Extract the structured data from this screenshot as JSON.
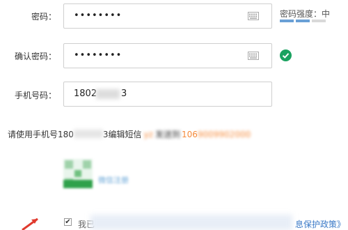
{
  "password": {
    "label": "密码：",
    "value": "••••••••"
  },
  "strength": {
    "text": "密码强度：中",
    "bars": [
      "#6aa0d6",
      "#6aa0d6",
      "#d9d9d9"
    ]
  },
  "confirm": {
    "label": "确认密码：",
    "value": "••••••••"
  },
  "phone": {
    "label": "手机号码：",
    "value_start": "1802",
    "value_end": "3"
  },
  "hint": {
    "prefix": "请使用手机号180",
    "middle": "3编辑短信",
    "code": "yz",
    "send": "发送到",
    "number": "106"
  },
  "qr": {
    "link_text": "微信注册"
  },
  "agreement": {
    "prefix": "我已",
    "policy": "息保护政策》"
  },
  "colors": {
    "accent": "#1aa260",
    "link": "#3b7ac7",
    "orange": "#f58a3a"
  }
}
